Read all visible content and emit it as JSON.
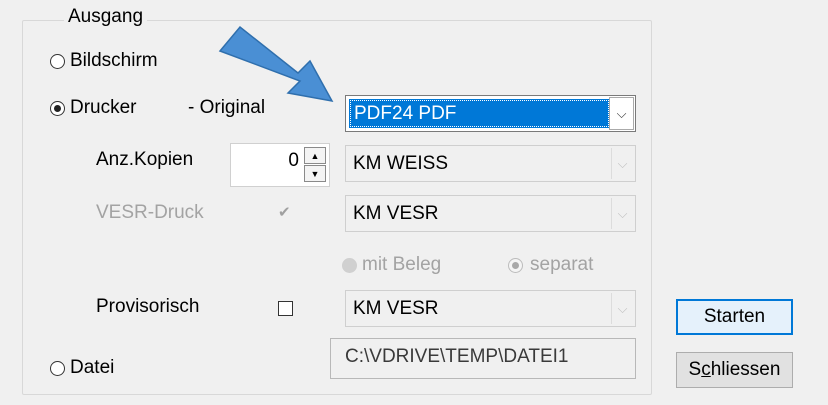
{
  "output_group": {
    "legend": "Ausgang",
    "radio_screen": "Bildschirm",
    "radio_printer": "Drucker",
    "original_label": "- Original",
    "radio_file": "Datei"
  },
  "printer": {
    "selected": "PDF24 PDF"
  },
  "copies": {
    "label": "Anz.Kopien",
    "value": "0",
    "printer": "KM WEISS"
  },
  "vesr": {
    "label": "VESR-Druck",
    "checked": true,
    "printer": "KM VESR",
    "option_with_receipt": "mit Beleg",
    "option_separate": "separat"
  },
  "provisional": {
    "label": "Provisorisch",
    "checked": false,
    "printer": "KM VESR"
  },
  "file": {
    "path": "C:\\VDRIVE\\TEMP\\DATEI1"
  },
  "buttons": {
    "start_label": "Starten",
    "close_prefix": "S",
    "close_underlined": "c",
    "close_suffix": "hliessen"
  },
  "colors": {
    "selection": "#0078d7",
    "arrow_fill": "#4a8fd4",
    "arrow_stroke": "#2f6fad"
  }
}
